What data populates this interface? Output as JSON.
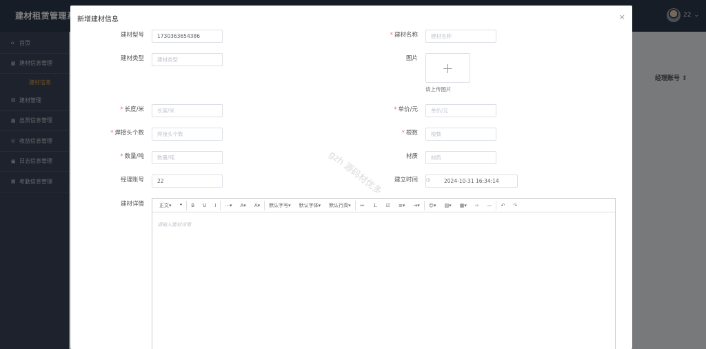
{
  "app": {
    "title": "建材租赁管理系统",
    "user": "22"
  },
  "sidebar": {
    "items": [
      {
        "label": "首页",
        "icon": "home-icon",
        "glyph": "⌂"
      },
      {
        "label": "建材信息管理",
        "icon": "grid-icon",
        "glyph": "▦"
      },
      {
        "label": "建材信息",
        "icon": "",
        "glyph": ""
      },
      {
        "label": "建材管理",
        "icon": "box-icon",
        "glyph": "▤"
      },
      {
        "label": "出货信息管理",
        "icon": "grid-icon",
        "glyph": "▦"
      },
      {
        "label": "收益信息管理",
        "icon": "coin-icon",
        "glyph": "◎"
      },
      {
        "label": "日志信息管理",
        "icon": "doc-icon",
        "glyph": "▣"
      },
      {
        "label": "考勤信息管理",
        "icon": "grid-icon",
        "glyph": "▦"
      }
    ]
  },
  "background": {
    "column_header": "经理账号 ⇕"
  },
  "dialog": {
    "title": "新增建材信息",
    "close": "×",
    "fields": {
      "model": {
        "label": "建材型号",
        "value": "1730363654386"
      },
      "name": {
        "label": "建材名称",
        "placeholder": "建材名称"
      },
      "type": {
        "label": "建材类型",
        "placeholder": "建材类型"
      },
      "image": {
        "label": "图片",
        "tip": "请上传图片",
        "plus": "+"
      },
      "length": {
        "label": "长度/米",
        "placeholder": "长度/米"
      },
      "price": {
        "label": "单价/元",
        "placeholder": "单价/元"
      },
      "welds": {
        "label": "焊接头个数",
        "placeholder": "焊接头个数"
      },
      "count": {
        "label": "根数",
        "placeholder": "根数"
      },
      "quantity": {
        "label": "数量/吨",
        "placeholder": "数量/吨"
      },
      "material": {
        "label": "材质",
        "placeholder": "材质"
      },
      "manager": {
        "label": "经理账号",
        "value": "22"
      },
      "created": {
        "label": "建立时间",
        "value": "2024-10-31 16:34:14"
      },
      "detail": {
        "label": "建材详情",
        "placeholder": "请输入建材详情"
      }
    },
    "toolbar": [
      "正文▾",
      "❝",
      "B",
      "U",
      "I",
      "···▾",
      "A▾",
      "A▾",
      "默认字号▾",
      "默认字体▾",
      "默认行高▾",
      "≔",
      "⒈",
      "☑",
      "≡▾",
      "⇥▾",
      "☺▾",
      "▨▾",
      "▦▾",
      "‹›",
      "—",
      "↶",
      "↷"
    ],
    "watermark": "gzh 源码材优多"
  }
}
